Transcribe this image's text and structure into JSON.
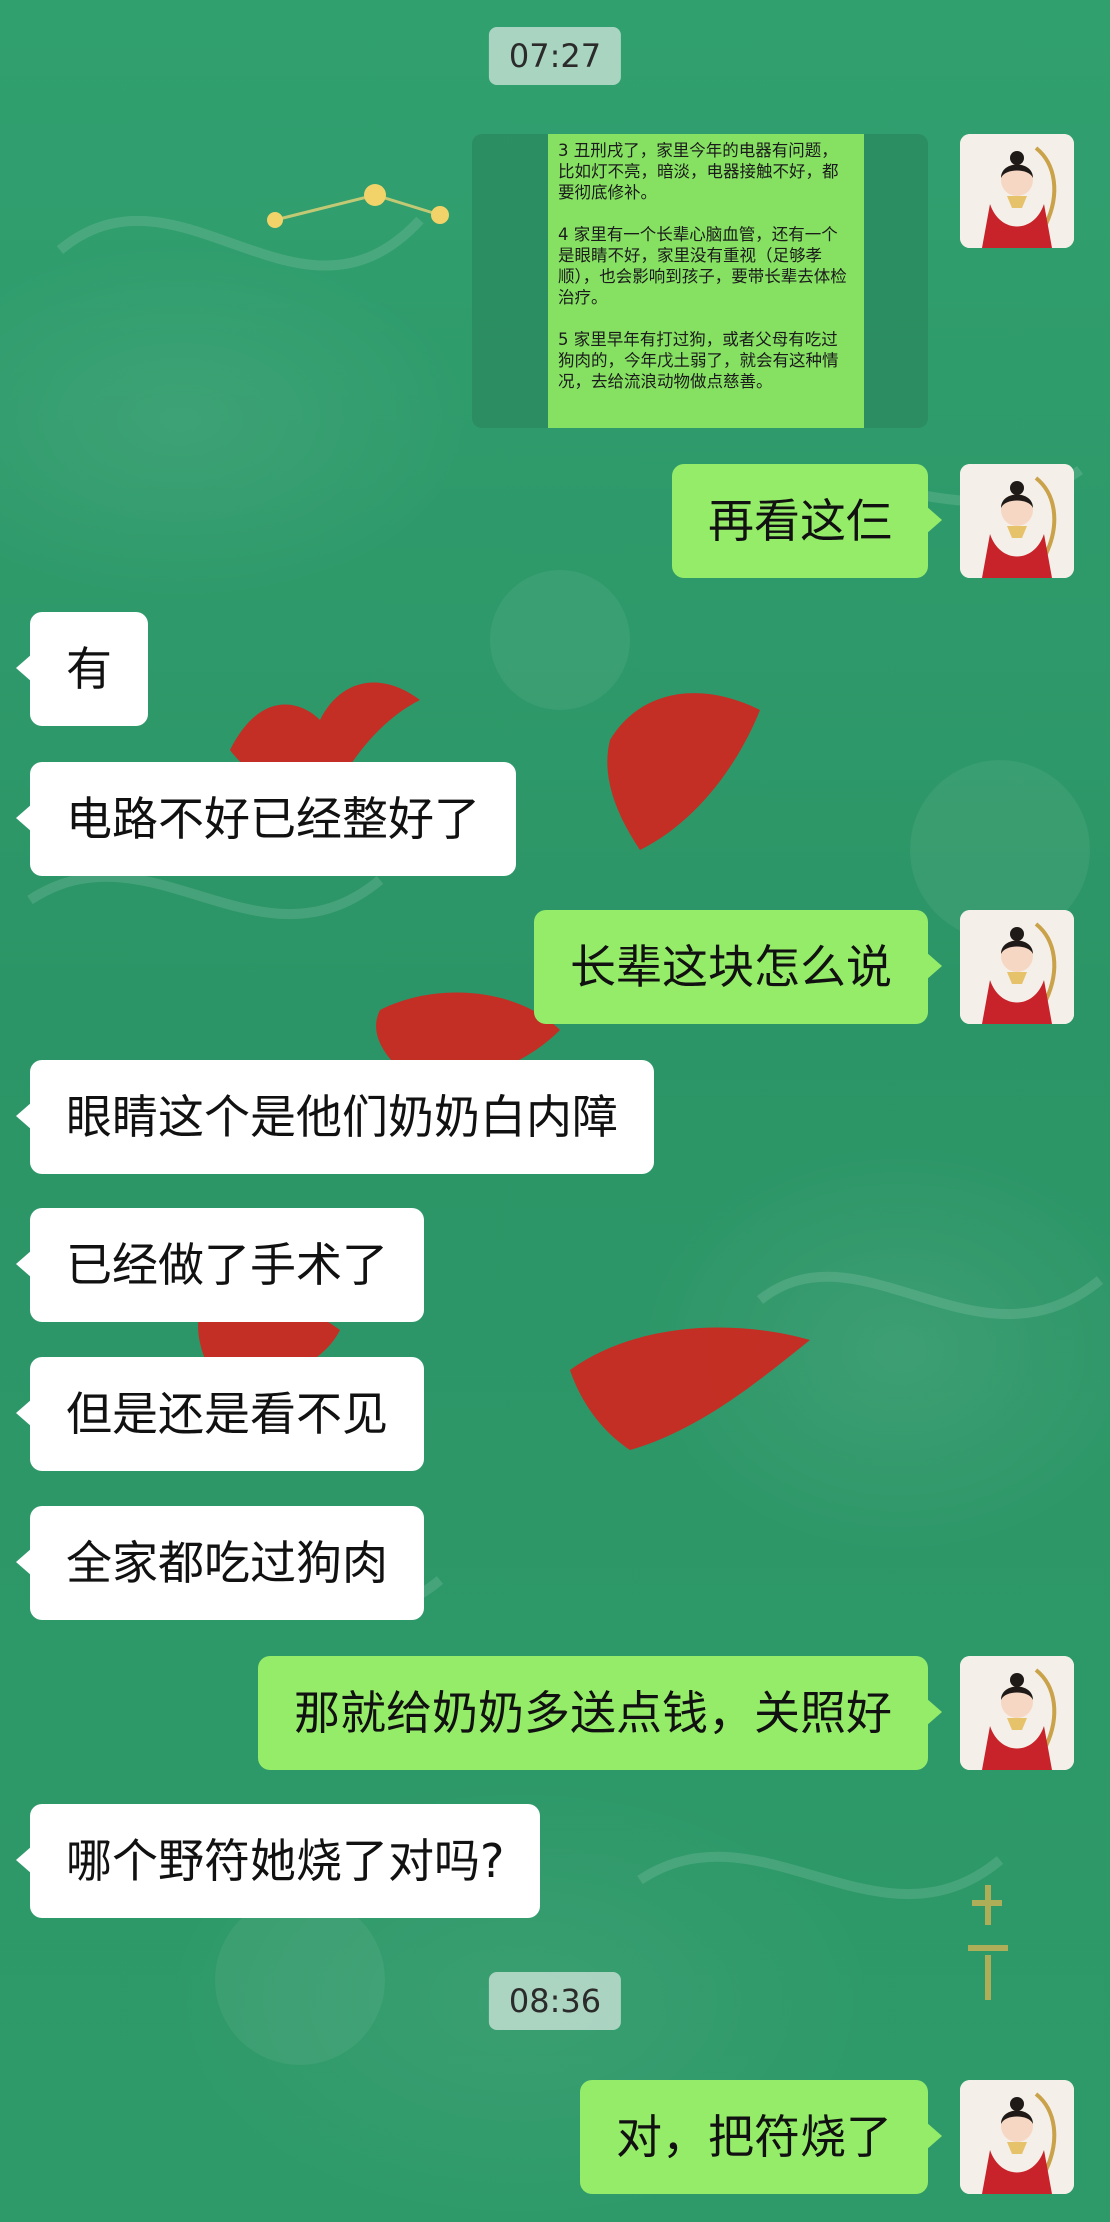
{
  "timestamps": [
    "07:27",
    "08:36"
  ],
  "image_message": {
    "paragraphs": [
      "3 丑刑戌了，家里今年的电器有问题，比如灯不亮，暗淡，电器接触不好，都要彻底修补。",
      "4 家里有一个长辈心脑血管，还有一个是眼睛不好，家里没有重视（足够孝顺），也会影响到孩子，要带长辈去体检治疗。",
      "5 家里早年有打过狗，或者父母有吃过狗肉的，今年戊土弱了，就会有这种情况，去给流浪动物做点慈善。"
    ]
  },
  "messages": [
    {
      "side": "right",
      "text": "再看这仨"
    },
    {
      "side": "left",
      "text": "有"
    },
    {
      "side": "left",
      "text": "电路不好已经整好了"
    },
    {
      "side": "right",
      "text": "长辈这块怎么说"
    },
    {
      "side": "left",
      "text": "眼睛这个是他们奶奶白内障"
    },
    {
      "side": "left",
      "text": "已经做了手术了"
    },
    {
      "side": "left",
      "text": "但是还是看不见"
    },
    {
      "side": "left",
      "text": "全家都吃过狗肉"
    },
    {
      "side": "right",
      "text": "那就给奶奶多送点钱，关照好"
    },
    {
      "side": "left",
      "text": "哪个野符她烧了对吗?"
    },
    {
      "side": "right",
      "text": "对，把符烧了"
    }
  ]
}
